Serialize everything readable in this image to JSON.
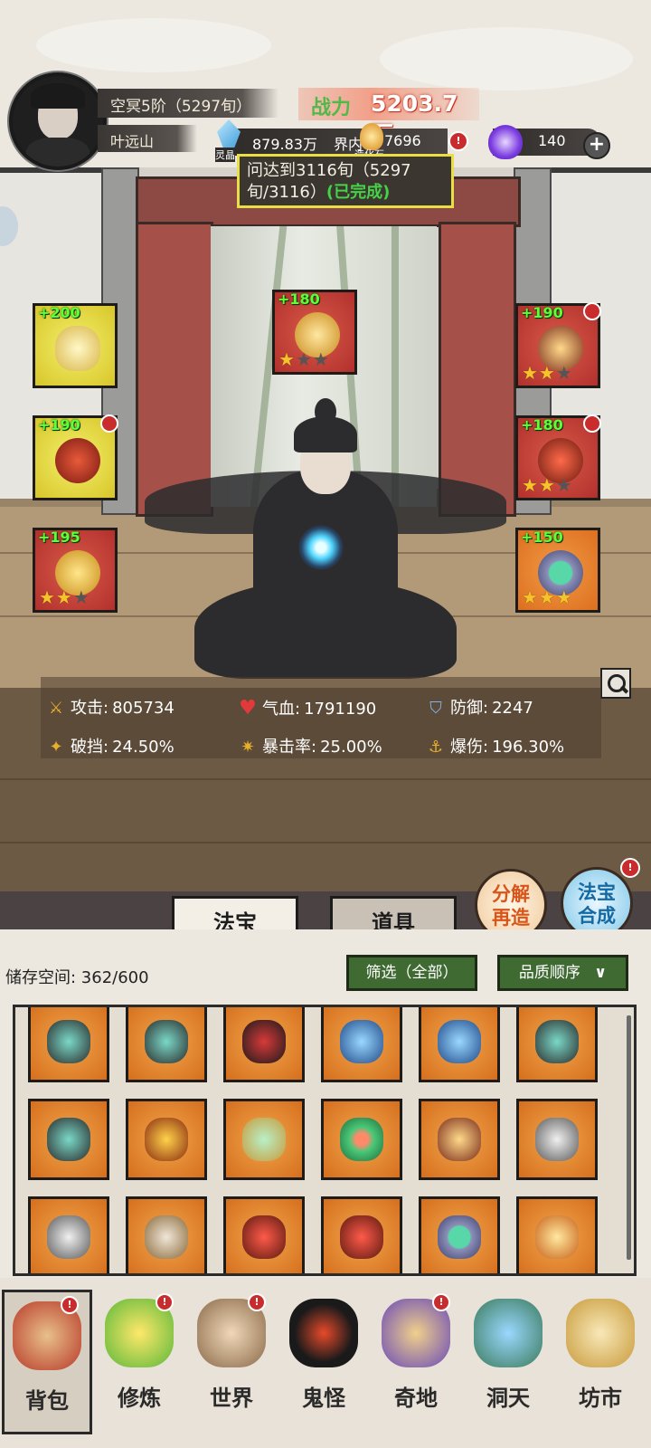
{
  "header": {
    "realm": "空冥5阶（5297旬）",
    "name": "叶远山",
    "power_label": "战力",
    "power_value": "5203.7万",
    "spirit_label": "灵晶",
    "spirit_value": "879.83万",
    "quest_text": "界内",
    "ore_label": "造化石",
    "ore_value": "7696",
    "gem_value": "140",
    "quest_line1": "问达到3116旬（5297",
    "quest_line2": "旬/3116）",
    "quest_status": "(已完成)"
  },
  "equipment": [
    {
      "bonus": "+200",
      "stars": 0,
      "color": "yellow",
      "icon": "mirror-icon"
    },
    {
      "bonus": "+180",
      "stars": 1,
      "color": "red",
      "icon": "golden-dragon-icon"
    },
    {
      "bonus": "+190",
      "stars": 2,
      "color": "red",
      "icon": "crown-icon"
    },
    {
      "bonus": "+190",
      "stars": 0,
      "color": "yellow",
      "icon": "demon-mask-icon"
    },
    {
      "bonus": "+180",
      "stars": 2,
      "color": "red",
      "icon": "amulet-icon"
    },
    {
      "bonus": "+195",
      "stars": 2,
      "color": "red",
      "icon": "golden-helm-icon"
    },
    {
      "bonus": "+150",
      "stars": 3,
      "color": "orange",
      "icon": "jade-ring-icon"
    }
  ],
  "stats": {
    "attack_label": "攻击:",
    "attack": "805734",
    "hp_label": "气血:",
    "hp": "1791190",
    "defense_label": "防御:",
    "defense": "2247",
    "break_label": "破挡:",
    "break": "24.50%",
    "crit_label": "暴击率:",
    "crit": "25.00%",
    "critdmg_label": "爆伤:",
    "critdmg": "196.30%"
  },
  "tabs": {
    "fabao": "法宝",
    "daoju": "道具"
  },
  "round_buttons": {
    "decompose_line1": "分解",
    "decompose_line2": "再造",
    "combine_line1": "法宝",
    "combine_line2": "合成"
  },
  "inventory": {
    "storage": "储存空间: 362/600",
    "filter": "筛选（全部）",
    "sort": "品质顺序",
    "items": [
      "bracer-icon",
      "bracer-icon",
      "dark-helm-icon",
      "blue-gauntlet-icon",
      "blue-gauntlet-icon",
      "bracer-icon",
      "bracer-icon",
      "golden-mask-icon",
      "dragon-icon",
      "vine-wreath-icon",
      "crown-icon",
      "hook-amulet-icon",
      "hook-amulet-icon",
      "pendant-icon",
      "red-amulet-icon",
      "red-amulet-icon",
      "jade-ring-icon",
      "sun-icon"
    ]
  },
  "nav": [
    {
      "label": "背包",
      "icon": "bag-icon",
      "alert": true
    },
    {
      "label": "修炼",
      "icon": "lotus-icon",
      "alert": true
    },
    {
      "label": "世界",
      "icon": "scroll-icon",
      "alert": true
    },
    {
      "label": "鬼怪",
      "icon": "demon-egg-icon",
      "alert": false
    },
    {
      "label": "奇地",
      "icon": "pagoda-icon",
      "alert": true
    },
    {
      "label": "洞天",
      "icon": "portal-icon",
      "alert": false
    },
    {
      "label": "坊市",
      "icon": "market-icon",
      "alert": false
    }
  ],
  "colors": {
    "slot_red": "#c43f37",
    "slot_yellow": "#e8dc45",
    "slot_orange": "#e6812f",
    "bonus_green": "#5cff3a",
    "quest_border": "#e9df45",
    "quest_done": "#46d246",
    "button_green": "#3f6b33",
    "power_red": "#e84a3a"
  }
}
